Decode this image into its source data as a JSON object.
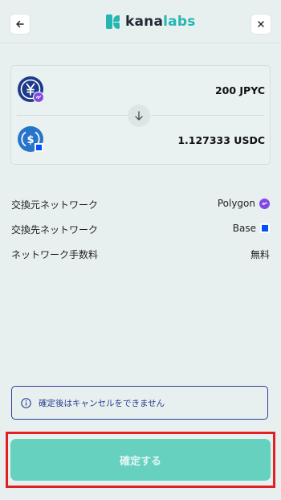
{
  "header": {
    "logo_part1": "kana",
    "logo_part2": "labs",
    "back_icon": "arrow-left-icon",
    "close_icon": "close-icon"
  },
  "swap": {
    "from_amount": "200 JPYC",
    "to_amount": "1.127333 USDC",
    "from_token_icon": "jpyc-token-icon",
    "to_token_icon": "usdc-token-icon",
    "direction_icon": "arrow-down-icon"
  },
  "details": {
    "source_network_label": "交換元ネットワーク",
    "source_network_value": "Polygon",
    "dest_network_label": "交換先ネットワーク",
    "dest_network_value": "Base",
    "fee_label": "ネットワーク手数料",
    "fee_value": "無料"
  },
  "notice": {
    "text": "確定後はキャンセルをできません"
  },
  "confirm": {
    "label": "確定する"
  },
  "colors": {
    "accent": "#25b6b1",
    "button": "#66d1bf",
    "highlight": "#e31e24",
    "polygon": "#8247e5",
    "base": "#0052ff",
    "usdc": "#2775ca",
    "jpyc": "#1d3a8a"
  }
}
